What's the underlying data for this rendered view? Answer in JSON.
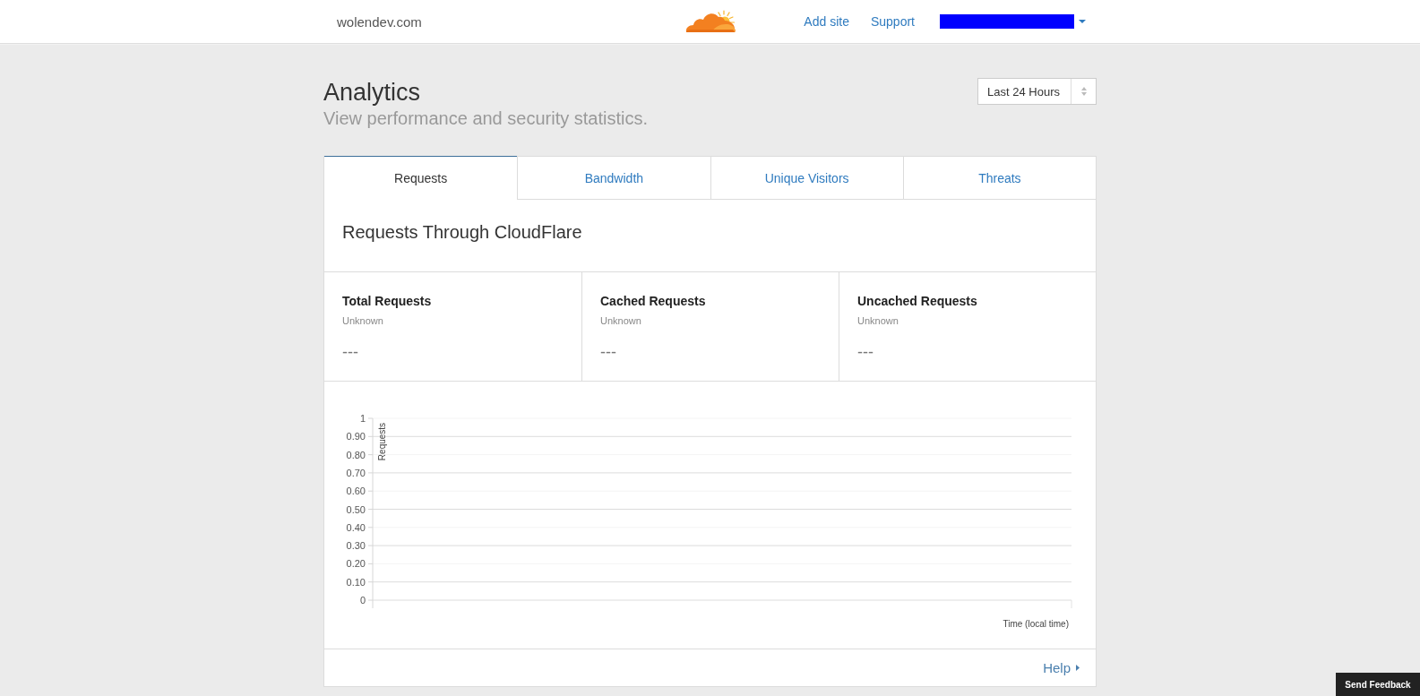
{
  "header": {
    "site": "wolendev.com",
    "nav": [
      {
        "label": "Add site"
      },
      {
        "label": "Support"
      }
    ]
  },
  "page": {
    "title": "Analytics",
    "subtitle": "View performance and security statistics.",
    "range_select": {
      "value": "Last 24 Hours"
    }
  },
  "tabs": [
    {
      "label": "Requests",
      "selected": true
    },
    {
      "label": "Bandwidth",
      "selected": false
    },
    {
      "label": "Unique Visitors",
      "selected": false
    },
    {
      "label": "Threats",
      "selected": false
    }
  ],
  "panel": {
    "title": "Requests Through CloudFlare",
    "stats": [
      {
        "label": "Total Requests",
        "status": "Unknown",
        "value": "---"
      },
      {
        "label": "Cached Requests",
        "status": "Unknown",
        "value": "---"
      },
      {
        "label": "Uncached Requests",
        "status": "Unknown",
        "value": "---"
      }
    ],
    "chart": {
      "chart_data": {
        "type": "line",
        "xlabel": "Time (local time)",
        "ylabel": "Requests",
        "categories": [
          null
        ],
        "ylim": [
          0,
          1
        ],
        "yticks": [
          {
            "value": 0,
            "label": "0"
          },
          {
            "value": 0.1,
            "label": "0.10"
          },
          {
            "value": 0.2,
            "label": "0.20"
          },
          {
            "value": 0.3,
            "label": "0.30"
          },
          {
            "value": 0.4,
            "label": "0.40"
          },
          {
            "value": 0.5,
            "label": "0.50"
          },
          {
            "value": 0.6,
            "label": "0.60"
          },
          {
            "value": 0.7,
            "label": "0.70"
          },
          {
            "value": 0.8,
            "label": "0.80"
          },
          {
            "value": 0.9,
            "label": "0.90"
          },
          {
            "value": 1,
            "label": "1"
          }
        ],
        "grid": true
      }
    },
    "help_link": "Help"
  },
  "feedback_button": "Send Feedback"
}
